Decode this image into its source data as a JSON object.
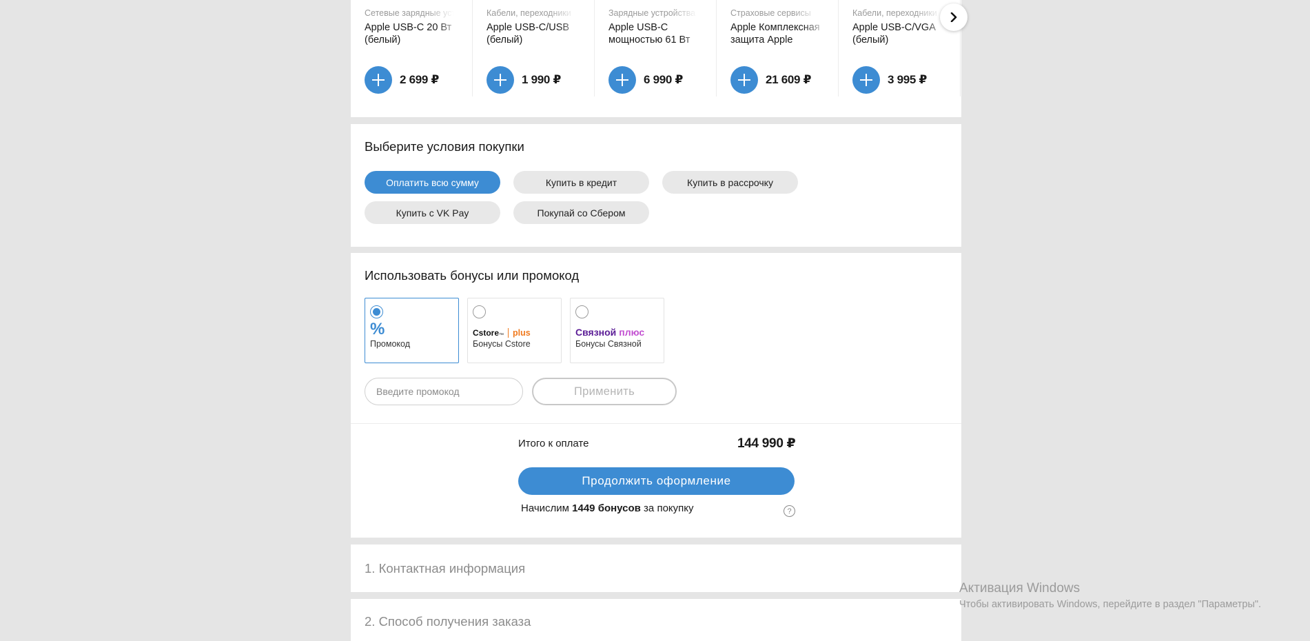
{
  "products": [
    {
      "category": "Сетевые зарядные устройства",
      "name": "Apple USB-C 20 Вт\n(белый)",
      "price": "2 699 ₽"
    },
    {
      "category": "Кабели, переходники",
      "name": "Apple USB-C/USB\n(белый)",
      "price": "1 990 ₽"
    },
    {
      "category": "Зарядные устройства",
      "name": "Apple USB-C\nмощностью 61 Вт",
      "price": "6 990 ₽"
    },
    {
      "category": "Страховые сервисы",
      "name": "Apple Комплексная\nзащита Apple",
      "price": "21 609 ₽"
    },
    {
      "category": "Кабели, переходники",
      "name": "Apple USB-C/VGA\n(белый)",
      "price": "3 995 ₽"
    }
  ],
  "purchase_terms": {
    "title": "Выберите условия покупки",
    "options": [
      {
        "label": "Оплатить всю сумму",
        "active": true
      },
      {
        "label": "Купить в кредит",
        "active": false
      },
      {
        "label": "Купить в рассрочку",
        "active": false
      },
      {
        "label": "Купить с VK Pay",
        "active": false
      },
      {
        "label": "Покупай со Сбером",
        "active": false
      }
    ]
  },
  "bonus": {
    "title": "Использовать бонусы или промокод",
    "options": [
      {
        "label": "Промокод",
        "selected": true,
        "logo": "percent-icon"
      },
      {
        "label": "Бонусы Cstore",
        "selected": false,
        "logo_text": "Cstore",
        "logo_tm": "™",
        "logo_plus": "plus"
      },
      {
        "label": "Бонусы Связной",
        "selected": false,
        "logo_text": "Связной",
        "logo_plus": "плюс"
      }
    ],
    "promo_placeholder": "Введите промокод",
    "apply_label": "Применить"
  },
  "summary": {
    "total_label": "Итого к оплате",
    "total_value": "144 990 ₽",
    "continue_label": "Продолжить оформление",
    "earn_prefix": "Начислим ",
    "earn_bold": "1449 бонусов",
    "earn_suffix": " за покупку",
    "help_glyph": "?"
  },
  "steps": [
    {
      "label": "1. Контактная информация"
    },
    {
      "label": "2. Способ получения заказа"
    }
  ],
  "windows_watermark": {
    "title": "Активация Windows",
    "subtitle": "Чтобы активировать Windows, перейдите в раздел \"Параметры\"."
  },
  "colors": {
    "accent": "#3d8cd3",
    "page_bg": "#e5e5e5",
    "cstore_orange": "#f07a1e",
    "svyaznoy_purple": "#5b1d96",
    "svyaznoy_pink": "#c24fd1"
  }
}
